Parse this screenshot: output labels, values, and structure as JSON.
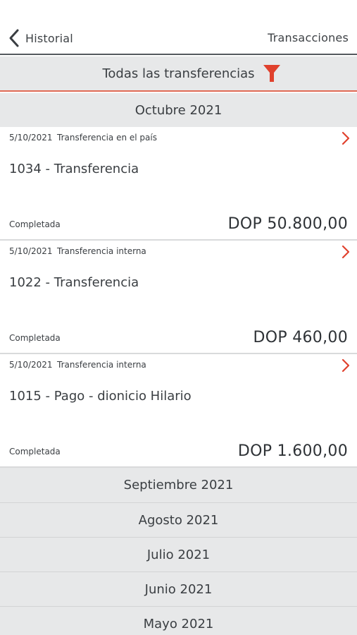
{
  "nav": {
    "back_label": "Historial",
    "title": "Transacciones"
  },
  "filter": {
    "label": "Todas las transferencias",
    "icon": "filter-icon"
  },
  "current_month": "Octubre 2021",
  "transactions": [
    {
      "date": "5/10/2021",
      "type": "Transferencia en el país",
      "title": "1034 - Transferencia",
      "status": "Completada",
      "amount": "DOP 50.800,00"
    },
    {
      "date": "5/10/2021",
      "type": "Transferencia interna",
      "title": "1022 - Transferencia",
      "status": "Completada",
      "amount": "DOP 460,00"
    },
    {
      "date": "5/10/2021",
      "type": "Transferencia interna",
      "title": "1015 - Pago - dionicio Hilario",
      "status": "Completada",
      "amount": "DOP 1.600,00"
    }
  ],
  "other_months": [
    "Septiembre 2021",
    "Agosto 2021",
    "Julio 2021",
    "Junio 2021",
    "Mayo 2021"
  ],
  "colors": {
    "accent": "#e0412d",
    "header_bg": "#e7e8e9",
    "text": "#3a3e42"
  }
}
